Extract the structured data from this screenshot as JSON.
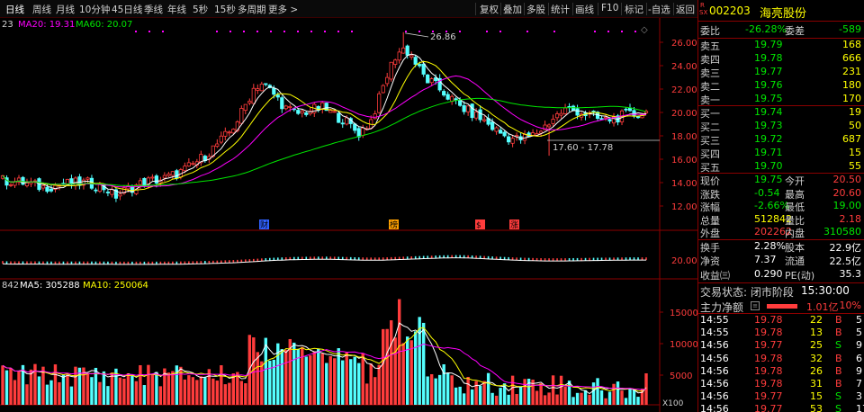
{
  "toolbar": {
    "tabs": [
      "日线",
      "周线",
      "月线",
      "10分钟",
      "45日线",
      "季线",
      "年线",
      "5秒",
      "15秒",
      "多周期",
      "更多 >"
    ],
    "active_tab": "日线",
    "right_buttons": [
      "复权",
      "叠加",
      "多股",
      "统计",
      "画线",
      "F10",
      "标记",
      "-自选",
      "返回"
    ]
  },
  "main_legend": {
    "prefix": "23",
    "ma20": "MA20: 19.31",
    "ma60": "MA60: 20.07"
  },
  "vol_legend": {
    "prefix": "842",
    "ma5": "MA5: 305288",
    "ma10": "MA10: 250064"
  },
  "price_axis": [
    "26.00",
    "24.00",
    "22.00",
    "20.00",
    "18.00",
    "16.00",
    "14.00",
    "12.00"
  ],
  "mid_axis": "20.00",
  "vol_axis": [
    "15000",
    "10000",
    "5000"
  ],
  "vol_unit": "X100",
  "annotations": {
    "high": "26.86",
    "range": "17.60 - 17.78"
  },
  "event_tags": [
    "财",
    "榜",
    "$",
    "涨"
  ],
  "stock": {
    "badge_top": "R",
    "badge_bottom": "SX",
    "code": "002203",
    "name": "海亮股份"
  },
  "commission": {
    "label1": "委比",
    "ratio": "-26.28%",
    "label2": "委差",
    "diff": "-589"
  },
  "asks": [
    {
      "label": "卖五",
      "price": "19.79",
      "vol": "168"
    },
    {
      "label": "卖四",
      "price": "19.78",
      "vol": "666"
    },
    {
      "label": "卖三",
      "price": "19.77",
      "vol": "231"
    },
    {
      "label": "卖二",
      "price": "19.76",
      "vol": "180"
    },
    {
      "label": "卖一",
      "price": "19.75",
      "vol": "170"
    }
  ],
  "bids": [
    {
      "label": "买一",
      "price": "19.74",
      "vol": "19"
    },
    {
      "label": "买二",
      "price": "19.73",
      "vol": "50"
    },
    {
      "label": "买三",
      "price": "19.72",
      "vol": "687"
    },
    {
      "label": "买四",
      "price": "19.71",
      "vol": "15"
    },
    {
      "label": "买五",
      "price": "19.70",
      "vol": "55"
    }
  ],
  "quote": [
    {
      "l1": "现价",
      "v1": "19.75",
      "l2": "今开",
      "v2": "20.50"
    },
    {
      "l1": "涨跌",
      "v1": "-0.54",
      "l2": "最高",
      "v2": "20.60"
    },
    {
      "l1": "涨幅",
      "v1": "-2.66%",
      "l2": "最低",
      "v2": "19.00"
    },
    {
      "l1": "总量",
      "v1": "512842",
      "l2": "量比",
      "v2": "2.18"
    },
    {
      "l1": "外盘",
      "v1": "202262",
      "l2": "内盘",
      "v2": "310580"
    }
  ],
  "stats": [
    {
      "l1": "换手",
      "v1": "2.28%",
      "l2": "股本",
      "v2": "22.9亿"
    },
    {
      "l1": "净资",
      "v1": "7.37",
      "l2": "流通",
      "v2": "22.5亿"
    },
    {
      "l1": "收益㈢",
      "v1": "0.290",
      "l2": "PE(动)",
      "v2": "35.3"
    }
  ],
  "trade_state": {
    "label": "交易状态: 闭市阶段",
    "time": "15:30:00"
  },
  "main_flow": {
    "label": "主力净额",
    "value": "1.01亿",
    "pct": "10%"
  },
  "ticks": [
    {
      "time": "14:55",
      "price": "19.78",
      "vol": "22",
      "side": "B",
      "n": "5"
    },
    {
      "time": "14:55",
      "price": "19.78",
      "vol": "13",
      "side": "B",
      "n": "5"
    },
    {
      "time": "14:56",
      "price": "19.77",
      "vol": "25",
      "side": "S",
      "n": "9"
    },
    {
      "time": "14:56",
      "price": "19.78",
      "vol": "32",
      "side": "B",
      "n": "6"
    },
    {
      "time": "14:56",
      "price": "19.78",
      "vol": "26",
      "side": "B",
      "n": "9"
    },
    {
      "time": "14:56",
      "price": "19.78",
      "vol": "31",
      "side": "B",
      "n": "7"
    },
    {
      "time": "14:56",
      "price": "19.77",
      "vol": "15",
      "side": "S",
      "n": "3"
    },
    {
      "time": "14:56",
      "price": "19.77",
      "vol": "53",
      "side": "S",
      "n": "17"
    }
  ],
  "colors": {
    "up": "#ff3c3c",
    "down": "#54ffff",
    "ma5": "#ffffff",
    "ma10": "#ffff00",
    "ma20": "#ff00ff",
    "ma60": "#00e600",
    "border": "#8b0000"
  }
}
